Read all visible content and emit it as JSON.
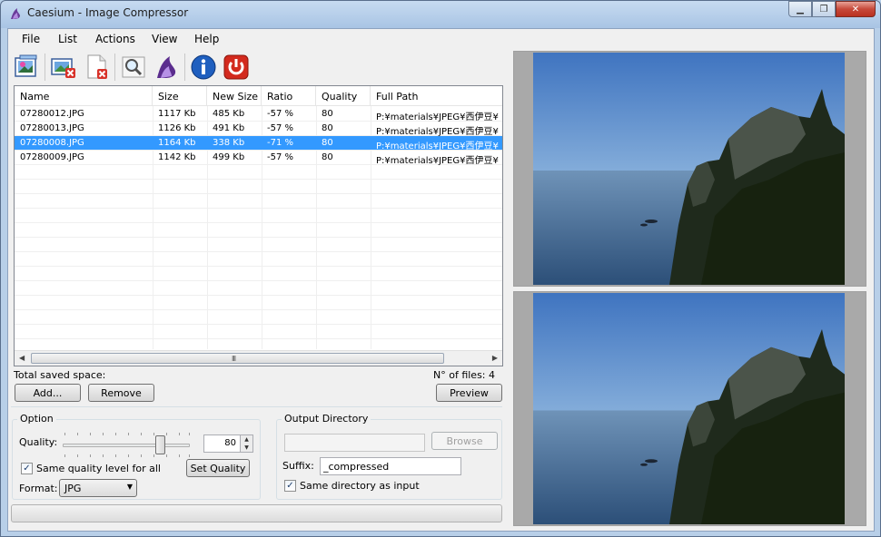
{
  "window": {
    "title": "Caesium - Image Compressor",
    "minimize_glyph": "▁",
    "restore_glyph": "❐",
    "close_glyph": "✕"
  },
  "menu": [
    "File",
    "List",
    "Actions",
    "View",
    "Help"
  ],
  "toolbar": {
    "buttons": [
      "open-images-icon",
      "remove-item-icon",
      "clear-list-icon",
      "preview-magnifier-icon",
      "compress-icon",
      "about-info-icon",
      "exit-power-icon"
    ]
  },
  "list": {
    "columns": [
      "Name",
      "Size",
      "New Size",
      "Ratio",
      "Quality",
      "Full Path"
    ],
    "rows": [
      {
        "name": "07280012.JPG",
        "size": "1117 Kb",
        "new_size": "485 Kb",
        "ratio": "-57 %",
        "quality": "80",
        "path": "P:¥materials¥JPEG¥西伊豆¥"
      },
      {
        "name": "07280013.JPG",
        "size": "1126 Kb",
        "new_size": "491 Kb",
        "ratio": "-57 %",
        "quality": "80",
        "path": "P:¥materials¥JPEG¥西伊豆¥"
      },
      {
        "name": "07280008.JPG",
        "size": "1164 Kb",
        "new_size": "338 Kb",
        "ratio": "-71 %",
        "quality": "80",
        "path": "P:¥materials¥JPEG¥西伊豆¥"
      },
      {
        "name": "07280009.JPG",
        "size": "1142 Kb",
        "new_size": "499 Kb",
        "ratio": "-57 %",
        "quality": "80",
        "path": "P:¥materials¥JPEG¥西伊豆¥"
      }
    ],
    "selected_index": 2,
    "scroll_grip": "III",
    "scroll_left": "◀",
    "scroll_right": "▶"
  },
  "status": {
    "total_saved_label": "Total saved space:",
    "files_label": "N°  of files: 4"
  },
  "buttons": {
    "add": "Add...",
    "remove": "Remove",
    "preview": "Preview",
    "set_quality": "Set Quality",
    "browse": "Browse"
  },
  "options": {
    "group_title": "Option",
    "quality_label": "Quality:",
    "quality_value": "80",
    "quality_level": 80,
    "spin_up": "▲",
    "spin_down": "▼",
    "same_quality_label": "Same quality level for all",
    "same_quality_checked": "✓",
    "format_label": "Format:",
    "format_value": "JPG",
    "format_arrow": "▼"
  },
  "output": {
    "group_title": "Output Directory",
    "directory_value": "",
    "suffix_label": "Suffix:",
    "suffix_value": "_compressed",
    "same_dir_label": "Same directory as input",
    "same_dir_checked": "✓"
  },
  "colors": {
    "selection": "#3399ff",
    "sky_top": "#4a7ec7",
    "sea": "#3e6a96"
  }
}
